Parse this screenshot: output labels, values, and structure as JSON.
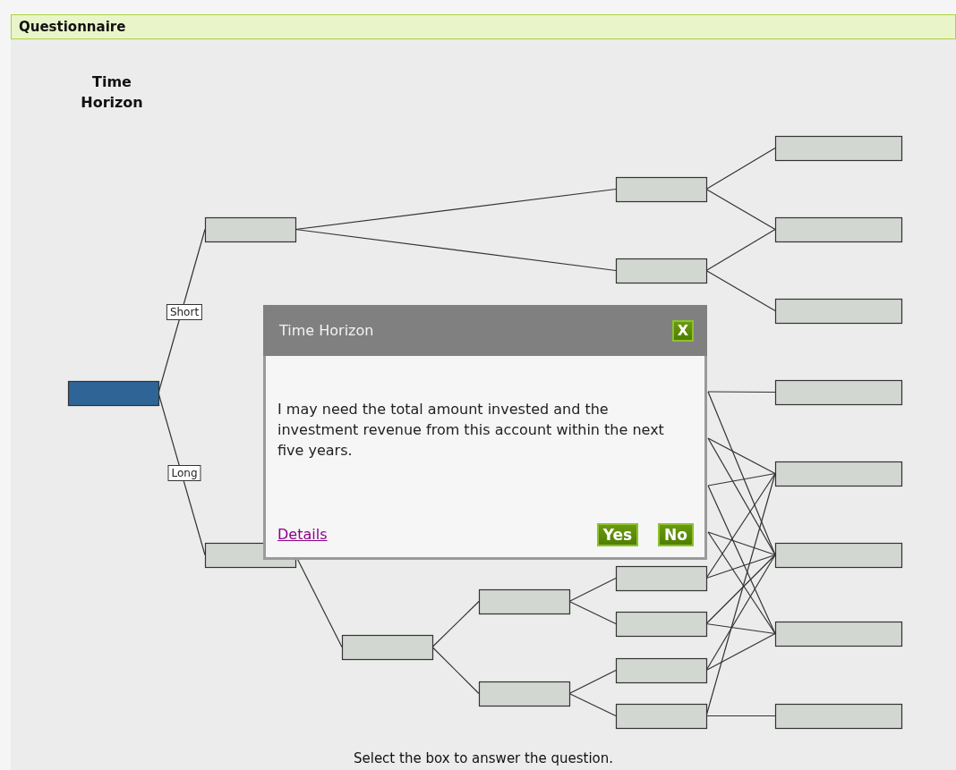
{
  "header": {
    "title": "Questionnaire"
  },
  "diagram": {
    "column_title": "Time Horizon",
    "nodes": [
      {
        "selected": true
      },
      {
        "selected": false
      },
      {
        "selected": false
      },
      {
        "selected": false
      },
      {
        "selected": false
      },
      {
        "selected": false
      },
      {
        "selected": false
      },
      {
        "selected": false
      },
      {
        "selected": false
      },
      {
        "selected": false
      },
      {
        "selected": false
      },
      {
        "selected": false
      },
      {
        "selected": false
      },
      {
        "selected": false
      },
      {
        "selected": false
      },
      {
        "selected": false
      },
      {
        "selected": false
      },
      {
        "selected": false
      },
      {
        "selected": false
      },
      {
        "selected": false
      }
    ],
    "edge_labels": [
      "Short",
      "Long"
    ],
    "instruction": "Select the box to answer the question."
  },
  "dialog": {
    "title": "Time Horizon",
    "close": "X",
    "text": "I may need the total amount invested and the investment revenue from this account within the next five years.",
    "link": "Details",
    "buttons": [
      "Yes",
      "No"
    ]
  }
}
